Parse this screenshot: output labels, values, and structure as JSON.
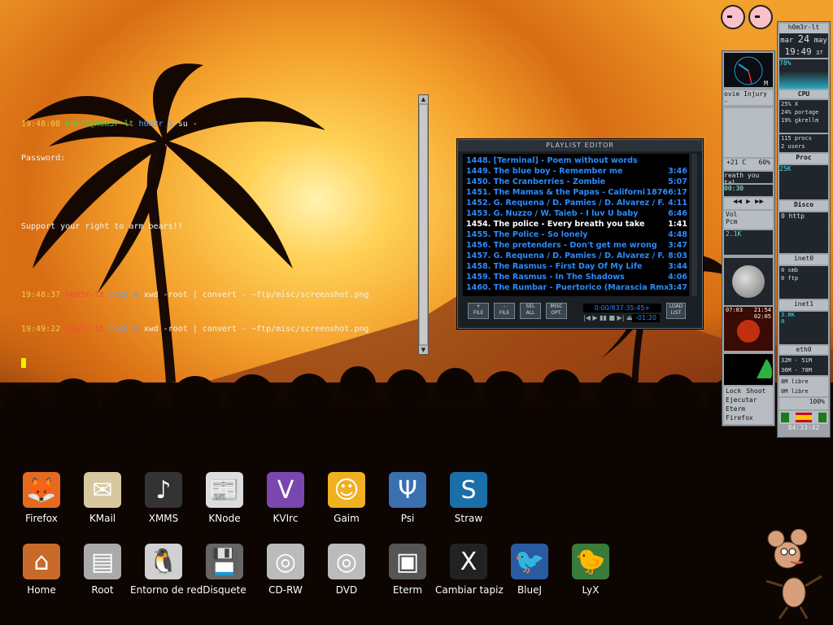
{
  "terminal": {
    "lines": [
      {
        "time": "19:48:08",
        "user": "h0m3r@h0m3r-lt",
        "dir": "h0m3r $",
        "cmd": "su -"
      },
      {
        "text": "Password:"
      },
      {
        "text": ""
      },
      {
        "text": "Support your right to arm bears!!"
      },
      {
        "text": ""
      },
      {
        "time": "19:48:37",
        "user": "h0m3r-lt",
        "dir": "root #",
        "cmd": "xwd -root | convert - ~ftp/misc/screenshot.png"
      },
      {
        "time": "19:49:22",
        "user": "h0m3r-lt",
        "dir": "root #",
        "cmd": "xwd -root | convert - ~ftp/misc/screenshot.png"
      }
    ]
  },
  "playlist": {
    "title": "PLAYLIST EDITOR",
    "items": [
      {
        "name": "1448. [Terminal] - Poem without words",
        "time": ""
      },
      {
        "name": "1449. The blue boy - Remember me",
        "time": "3:46"
      },
      {
        "name": "1450. The Cranberries - Zombie",
        "time": "5:07"
      },
      {
        "name": "1451. The Mamas & the Papas - Californi...",
        "time": "18766:17"
      },
      {
        "name": "1452. G. Requena / D. Pamies / D. Alvarez / F. ...",
        "time": "4:11"
      },
      {
        "name": "1453. G. Nuzzo / W. Taieb - I luv U baby",
        "time": "6:46"
      },
      {
        "name": "1454. The police - Every breath you take",
        "time": "1:41"
      },
      {
        "name": "1455. The Police - So lonely",
        "time": "4:48"
      },
      {
        "name": "1456. The pretenders - Don't get me wrong",
        "time": "3:47"
      },
      {
        "name": "1457. G. Requena / D. Pamies / D. Alvarez / F. ...",
        "time": "8:03"
      },
      {
        "name": "1458. The Rasmus - First Day Of My Life",
        "time": "3:44"
      },
      {
        "name": "1459. The Rasmus - In The Shadows",
        "time": "4:06"
      },
      {
        "name": "1460. The Rumbar - Puertorico (Marascia Rmx)",
        "time": "3:47"
      }
    ],
    "current_index": 6,
    "buttons": [
      {
        "label": "+\nFILE"
      },
      {
        "label": "-\nFILE"
      },
      {
        "label": "SEL\nALL"
      },
      {
        "label": "MISC\nOPT."
      }
    ],
    "time_display": "0:00/837:35:45+",
    "remaining": "-01:20",
    "load_list": "LOAD\nLIST"
  },
  "dock_left": {
    "clock_label": "M",
    "song": "ovie Injury -",
    "temp": "+21 C",
    "temp_pct": "60%",
    "song2": "reath you tal",
    "elapsed": "00:30",
    "vol_label": "Vol",
    "pcm_label": "Pcm",
    "net": "2.1K",
    "sun_times": {
      "rise": "07:03",
      "set": "21:54",
      "len": "02:05"
    },
    "menu": [
      "Lock",
      "Shoot",
      "Ejecutar",
      "Eterm",
      "Firefox"
    ]
  },
  "dock_right": {
    "host": "h0m3r-lt",
    "day": "mar",
    "date": "24",
    "month": "may",
    "time": "19:49",
    "secs": "37",
    "mem_pct": "78%",
    "cpu_label": "CPU",
    "cpu_lines": [
      "25% X",
      "24% portage",
      "19% gkrellm"
    ],
    "procs": "115 procs",
    "users": "2 users",
    "proc_label": "Proc",
    "proc_val": "25K",
    "disk_label": "Disco",
    "disk_line": "0 http",
    "iface0": "inet0",
    "iface0_lines": [
      "0 smb",
      "0 ftp"
    ],
    "iface1": "inet1",
    "iface1_val": "3.0K",
    "iface1_line": "0",
    "eth": "eth0",
    "mem_lines": [
      "32M - 51M",
      "36M - 78M"
    ],
    "free1": "8M libre",
    "free2": "0M libre",
    "battery": "100%",
    "uptime": "84:33:42"
  },
  "icons_row1": [
    "Firefox",
    "KMail",
    "XMMS",
    "KNode",
    "KVIrc",
    "Gaim",
    "Psi",
    "Straw"
  ],
  "icons_row2": [
    "Home",
    "Root",
    "Entorno de red",
    "Disquete",
    "CD-RW",
    "DVD",
    "Eterm",
    "Cambiar tapiz",
    "BlueJ",
    "LyX"
  ],
  "icon_glyphs": {
    "Firefox": "🦊",
    "KMail": "✉",
    "XMMS": "♪",
    "KNode": "📰",
    "KVIrc": "V",
    "Gaim": "☺",
    "Psi": "Ψ",
    "Straw": "S",
    "Home": "⌂",
    "Root": "▤",
    "Entorno de red": "🐧",
    "Disquete": "💾",
    "CD-RW": "◎",
    "DVD": "◎",
    "Eterm": "▣",
    "Cambiar tapiz": "X",
    "BlueJ": "🐦",
    "LyX": "🐤"
  }
}
